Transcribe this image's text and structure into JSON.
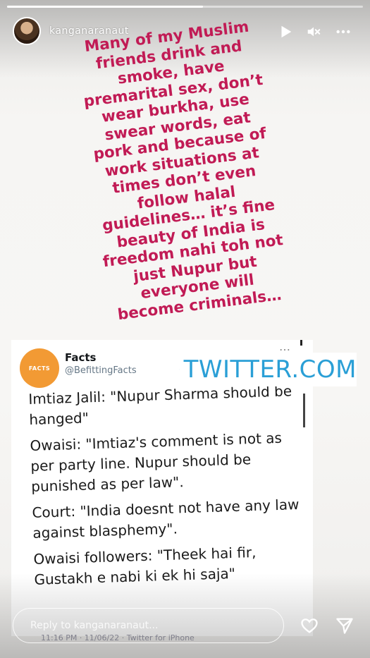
{
  "story": {
    "username": "kanganaranaut",
    "progress": 0.55,
    "overlay_text": "Many of my Muslim\nfriends drink and\nsmoke, have\npremarital sex, don’t\nwear burkha, use\nswear words, eat\npork and because of\nwork situations at\ntimes don’t even\nfollow halal\nguidelines… it’s fine\nbeauty of India is\nfreedom nahi toh not\njust Nupur but\neveryone will\nbecome criminals…"
  },
  "controls": {
    "play_icon": "play-icon",
    "mute_icon": "mute-icon",
    "more_icon": "more-icon"
  },
  "tweet": {
    "avatar_text": "FACTS",
    "name": "Facts",
    "handle": "@BefittingFacts",
    "more": "…",
    "lines": [
      "Imtiaz Jalil: \"Nupur Sharma should be hanged\"",
      "Owaisi: \"Imtiaz's comment is not as per party line. Nupur should be punished as per law\".",
      "Court: \"India doesnt not have any law against blasphemy\".",
      "Owaisi followers: \"Theek hai fir, Gustakh e nabi ki ek hi saja\""
    ],
    "timestamp": "11:16 PM · 11/06/22 · Twitter for iPhone"
  },
  "link": {
    "text": "TWITTER.COM",
    "icon": "link-icon"
  },
  "reply": {
    "placeholder": "Reply to kanganaranaut..."
  },
  "actions": {
    "like_icon": "heart-icon",
    "share_icon": "send-icon"
  },
  "colors": {
    "overlay_text": "#c11b55",
    "link": "#2a9fd6",
    "avatar": "#f29a34"
  }
}
